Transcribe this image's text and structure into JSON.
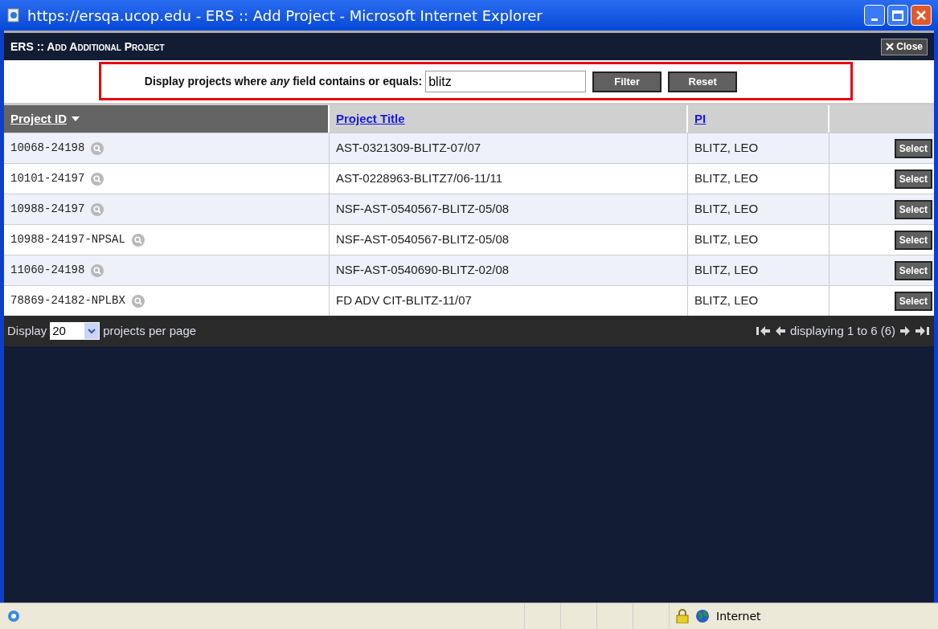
{
  "window": {
    "title": "https://ersqa.ucop.edu - ERS :: Add Project - Microsoft Internet Explorer"
  },
  "dialog": {
    "title": "ERS :: Add Additional Project",
    "close_label": "Close"
  },
  "filter": {
    "label": "Display projects where *any* field contains or equals:",
    "value": "blitz",
    "buttons": [
      "Filter",
      "Reset"
    ]
  },
  "table": {
    "columns": [
      {
        "label": "Project ID",
        "sorted": true
      },
      {
        "label": "Project Title",
        "sorted": false
      },
      {
        "label": "PI",
        "sorted": false
      }
    ],
    "rows": [
      {
        "id": "10068-24198",
        "title": "AST-0321309-BLITZ-07/07",
        "pi": "BLITZ, LEO",
        "action": "Select"
      },
      {
        "id": "10101-24197",
        "title": "AST-0228963-BLITZ7/06-11/11",
        "pi": "BLITZ, LEO",
        "action": "Select"
      },
      {
        "id": "10988-24197",
        "title": "NSF-AST-0540567-BLITZ-05/08",
        "pi": "BLITZ, LEO",
        "action": "Select"
      },
      {
        "id": "10988-24197-NPSAL",
        "title": "NSF-AST-0540567-BLITZ-05/08",
        "pi": "BLITZ, LEO",
        "action": "Select"
      },
      {
        "id": "11060-24198",
        "title": "NSF-AST-0540690-BLITZ-02/08",
        "pi": "BLITZ, LEO",
        "action": "Select"
      },
      {
        "id": "78869-24182-NPLBX",
        "title": "FD ADV CIT-BLITZ-11/07",
        "pi": "BLITZ, LEO",
        "action": "Select"
      }
    ]
  },
  "footer": {
    "display_label": "Display",
    "per_page": "20",
    "per_page_suffix": "projects per page",
    "paging": "displaying 1 to 6 (6)"
  },
  "status_bar": {
    "zone": "Internet"
  }
}
